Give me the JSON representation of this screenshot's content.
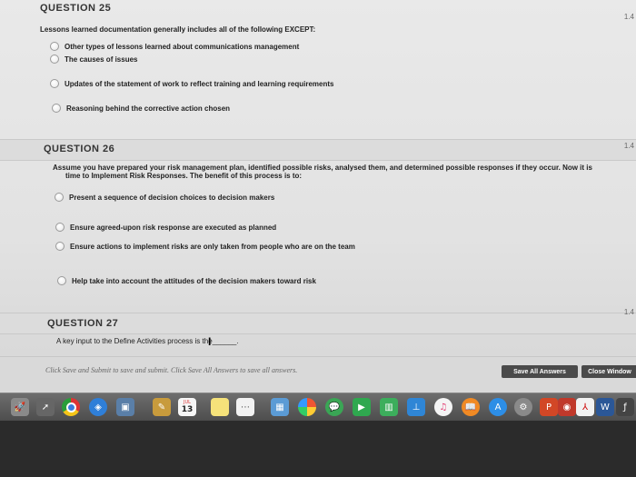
{
  "q25": {
    "title": "QUESTION 25",
    "points": "1.4",
    "prompt": "Lessons learned documentation generally includes all of the following EXCEPT:",
    "options": [
      "Other types of lessons learned about communications management",
      "The causes of issues",
      "Updates of the statement of work to reflect training and learning requirements",
      "Reasoning behind the corrective action chosen"
    ]
  },
  "q26": {
    "title": "QUESTION 26",
    "points": "1.4",
    "prompt_line1": "Assume you have prepared your risk management plan, identified possible risks, analysed them, and determined possible responses if they occur. Now it is",
    "prompt_line2": "time to Implement Risk Responses. The benefit of this process is to:",
    "options": [
      "Present a sequence of decision choices to decision makers",
      "Ensure agreed-upon risk response are executed as planned",
      "Ensure actions to implement risks are only taken from people who are on the team",
      "Help take into account the attitudes of the decision makers toward risk"
    ]
  },
  "q27": {
    "title": "QUESTION 27",
    "points": "1.4",
    "prompt": "A key input to the Define Activities process is the______."
  },
  "footer": {
    "note": "Click Save and Submit to save and submit. Click Save All Answers to save all answers.",
    "save_all": "Save All Answers",
    "close_window": "Close Window"
  },
  "dock": {
    "calendar_day": "13",
    "calendar_month": "JUL",
    "icons": [
      "launchpad-icon",
      "chrome-icon",
      "safari-icon",
      "preview-icon",
      "notes-icon",
      "calendar-icon",
      "stickies-icon",
      "reminders-icon",
      "photos-app-icon",
      "pinwheel-icon",
      "messages-icon",
      "facetime-icon",
      "numbers-icon",
      "keynote-icon",
      "itunes-icon",
      "ibooks-icon",
      "app-store-icon",
      "system-preferences-icon",
      "powerpoint-icon",
      "photo-booth-icon",
      "acrobat-icon",
      "word-icon",
      "textedit-icon",
      "script-icon"
    ]
  }
}
